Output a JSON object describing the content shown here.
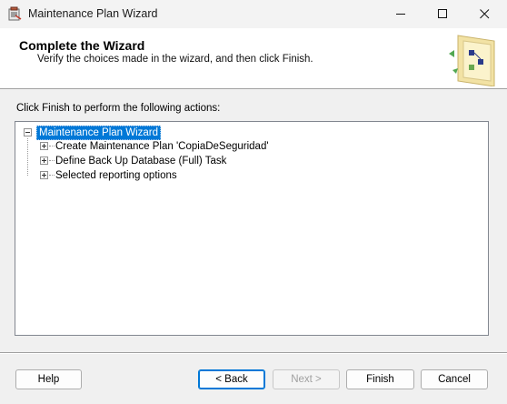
{
  "window": {
    "title": "Maintenance Plan Wizard",
    "minimize_glyph": "—",
    "maximize_glyph": "☐",
    "close_glyph": "✕"
  },
  "header": {
    "title": "Complete the Wizard",
    "subtitle": "Verify the choices made in the wizard, and then click Finish."
  },
  "instruction": "Click Finish to perform the following actions:",
  "tree": {
    "root": {
      "label": "Maintenance Plan Wizard",
      "expanded": true,
      "selected": true
    },
    "items": [
      {
        "label": "Create Maintenance Plan 'CopiaDeSeguridad'",
        "expanded": false
      },
      {
        "label": "Define Back Up Database (Full) Task",
        "expanded": false
      },
      {
        "label": "Selected reporting options",
        "expanded": false
      }
    ]
  },
  "buttons": {
    "help": "Help",
    "back": "< Back",
    "next": "Next >",
    "finish": "Finish",
    "cancel": "Cancel"
  },
  "colors": {
    "selection": "#0078d7",
    "focus_border": "#0078d7"
  }
}
